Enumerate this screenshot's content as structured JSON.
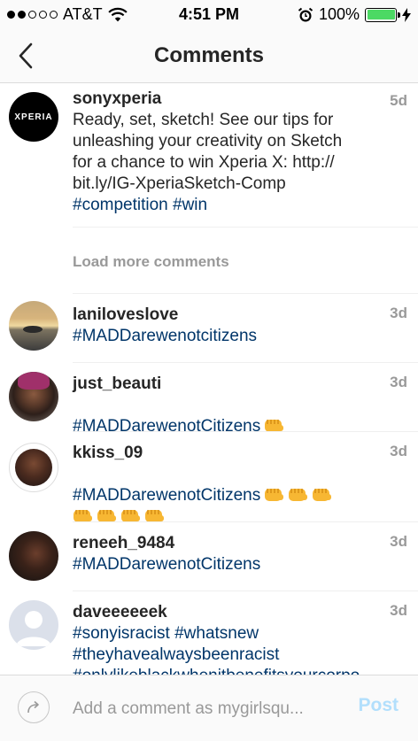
{
  "status_bar": {
    "carrier": "AT&T",
    "time": "4:51 PM",
    "battery_percent": "100%",
    "signal_bars_filled": 2,
    "signal_bars_total": 5,
    "battery_color": "#4cd964"
  },
  "nav": {
    "title": "Comments",
    "back_icon": "chevron-left-icon"
  },
  "caption": {
    "username": "sonyxperia",
    "avatar_text": "XPERIA",
    "time": "5d",
    "text": "Ready, set, sketch! See our tips for\nunleashing your creativity on Sketch\nfor a chance to win Xperia X: http://\nbit.ly/IG-XperiaSketch-Comp",
    "hashtags": "#competition #win"
  },
  "load_more": "Load more comments",
  "comments": [
    {
      "username": "laniloveslove",
      "time": "3d",
      "text": "#MADDarewenotcitizens"
    },
    {
      "username": "just_beauti",
      "time": "3d",
      "text": "#MADDarewenotCitizens"
    },
    {
      "username": "kkiss_09",
      "time": "3d",
      "text": "#MADDarewenotCitizens"
    },
    {
      "username": "reneeh_9484",
      "time": "3d",
      "text": "#MADDarewenotCitizens"
    },
    {
      "username": "daveeeeeek",
      "time": "3d",
      "text": "#sonyisracist #whatsnew\n#theyhavealwaysbeenracist\n#onlylikeblackwhenitbenefitsyourcorpo"
    }
  ],
  "input": {
    "placeholder": "Add a comment as mygirlsqu...",
    "post_label": "Post"
  },
  "colors": {
    "hashtag": "#003569",
    "muted": "#999999",
    "post_disabled": "#b2dffc"
  }
}
